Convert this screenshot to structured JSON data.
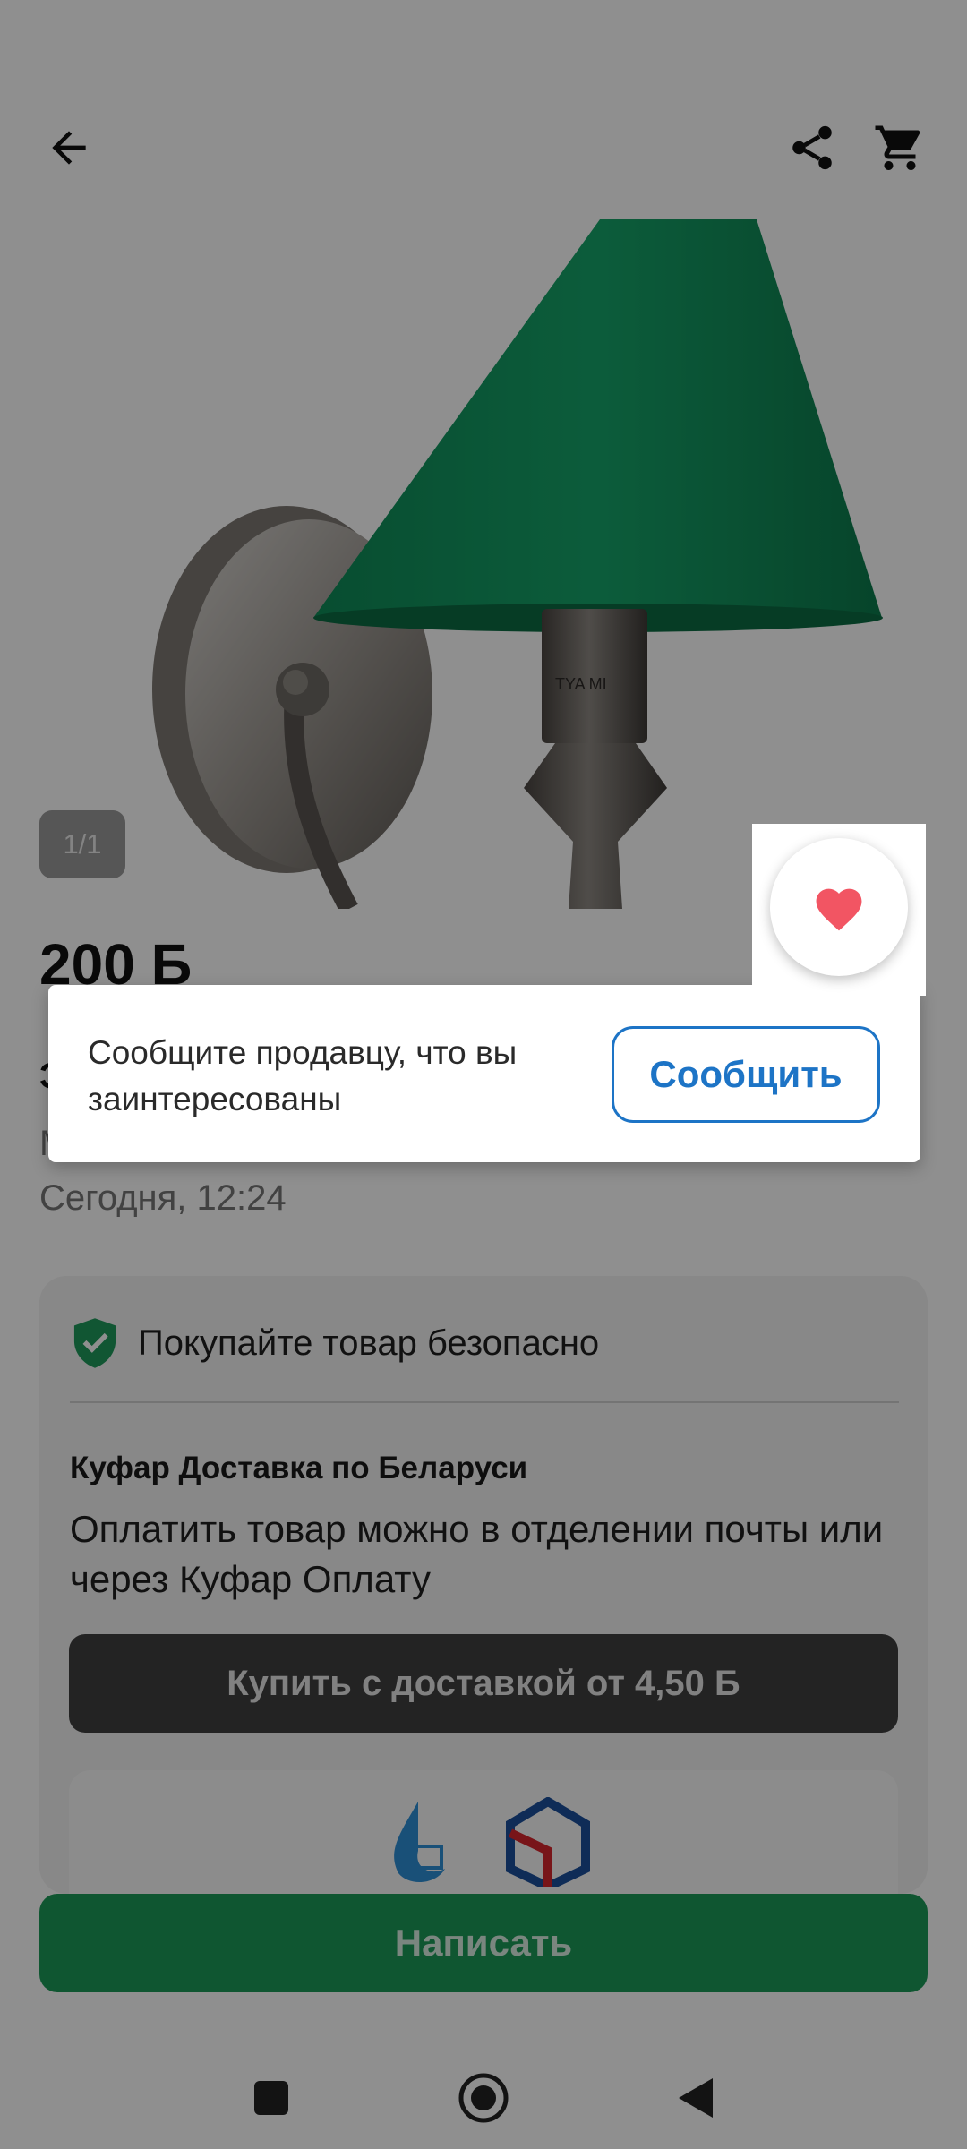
{
  "product": {
    "price": "200 Ƃ",
    "title": "Э",
    "location": "М",
    "date": "Сегодня, 12:24",
    "image_counter": "1/1"
  },
  "safe_purchase": {
    "header": "Покупайте товар безопасно",
    "delivery_title": "Куфар Доставка по Беларуси",
    "delivery_desc": "Оплатить товар можно в отделении почты или через Куфар Оплату",
    "buy_button": "Купить с доставкой от 4,50 Ƃ"
  },
  "popup": {
    "text": "Сообщите продавцу, что вы заинтересованы",
    "button": "Сообщить"
  },
  "bottom_button": "Написать",
  "icons": {
    "back": "arrow-left-icon",
    "share": "share-icon",
    "cart": "cart-icon",
    "favorite": "heart-icon",
    "shield": "shield-check-icon"
  },
  "colors": {
    "accent_green": "#1c9a58",
    "accent_blue": "#1d74c6",
    "heart_red": "#f25563",
    "shade_green": "#0f6b43"
  }
}
